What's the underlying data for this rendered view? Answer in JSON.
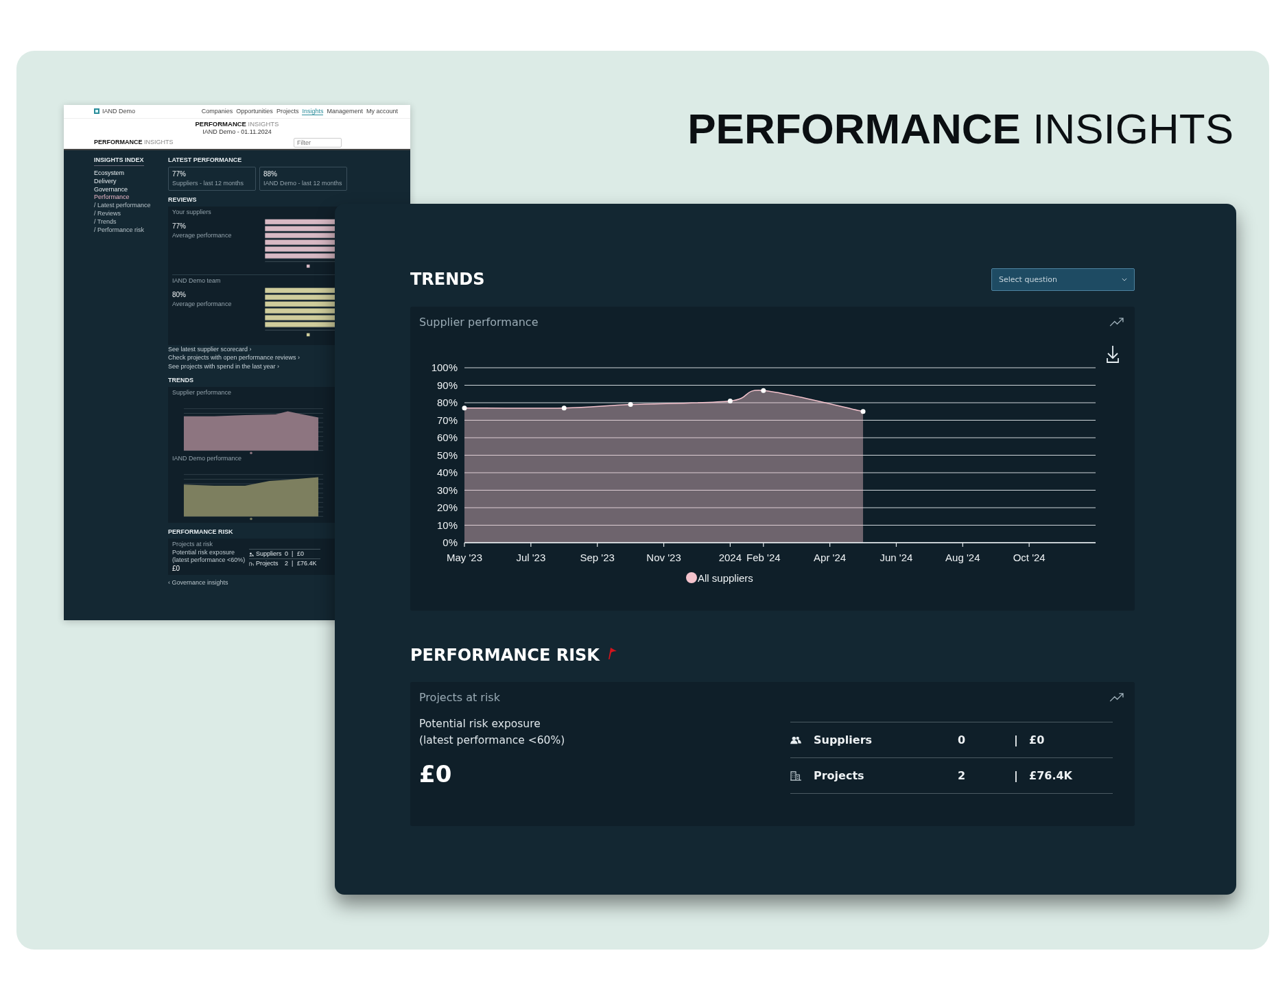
{
  "heading": {
    "bold": "PERFORMANCE",
    "light": "INSIGHTS"
  },
  "preview": {
    "brand": "IAND Demo",
    "nav": [
      {
        "label": "Companies",
        "selected": false
      },
      {
        "label": "Opportunities",
        "selected": false
      },
      {
        "label": "Projects",
        "selected": false
      },
      {
        "label": "Insights",
        "selected": true
      },
      {
        "label": "Management",
        "selected": false
      },
      {
        "label": "My account",
        "selected": false
      }
    ],
    "title": {
      "bold": "PERFORMANCE",
      "light": "INSIGHTS"
    },
    "subtitle": "IAND Demo - 01.11.2024",
    "section_title": {
      "bold": "PERFORMANCE",
      "light": "INSIGHTS"
    },
    "filter": {
      "placeholder": "Filter"
    },
    "index": {
      "title": "INSIGHTS INDEX",
      "items": [
        {
          "label": "Ecosystem",
          "selected": false
        },
        {
          "label": "Delivery",
          "selected": false
        },
        {
          "label": "Governance",
          "selected": false
        },
        {
          "label": "Performance",
          "selected": true
        }
      ],
      "subitems": [
        "/ Latest performance",
        "/ Reviews",
        "/ Trends",
        "/ Performance risk"
      ]
    },
    "latest": {
      "title": "LATEST PERFORMANCE",
      "cards": [
        {
          "value": "77%",
          "label": "Suppliers - last 12 months"
        },
        {
          "value": "88%",
          "label": "IAND Demo - last 12 months"
        }
      ]
    },
    "reviews": {
      "title": "REVIEWS",
      "panels": [
        {
          "name": "Your suppliers",
          "value": "77%",
          "label": "Average performance",
          "color": "#d8b9c4"
        },
        {
          "name": "IAND Demo team",
          "value": "80%",
          "label": "Average performance",
          "color": "#cfcd9c"
        }
      ]
    },
    "links": [
      "See latest supplier scorecard ›",
      "Check projects with open performance reviews ›",
      "See projects with spend in the last year ›"
    ],
    "trends": {
      "title": "TRENDS",
      "panels": [
        {
          "name": "Supplier performance",
          "color": "#8d7580"
        },
        {
          "name": "IAND Demo performance",
          "color": "#7d7f5f"
        }
      ]
    },
    "risk": {
      "title": "PERFORMANCE RISK",
      "card": "Projects at risk",
      "label": "Potential risk exposure",
      "sublabel": "(latest performance <60%)",
      "value": "£0",
      "rows": [
        {
          "kind": "suppliers",
          "label": "Suppliers",
          "count": "0",
          "divider": "|",
          "amount": "£0"
        },
        {
          "kind": "projects",
          "label": "Projects",
          "count": "2",
          "divider": "|",
          "amount": "£76.4K"
        }
      ]
    },
    "back": "‹ Governance insights"
  },
  "trends": {
    "title": "TRENDS",
    "select": {
      "placeholder": "Select question"
    },
    "card": {
      "title": "Supplier performance",
      "chart_data": {
        "type": "area",
        "categories": [
          "May '23",
          null,
          "Jul '23",
          null,
          "Sep '23",
          null,
          "Nov '23",
          null,
          "2024",
          "Feb '24",
          null,
          "Apr '24",
          null,
          "Jun '24",
          null,
          "Aug '24",
          null,
          "Oct '24",
          null
        ],
        "series": [
          {
            "name": "All suppliers",
            "color": "#f4c3cd",
            "values": [
              77,
              null,
              null,
              77,
              null,
              79,
              null,
              null,
              81,
              87,
              null,
              null,
              75,
              null,
              null,
              null,
              null,
              null,
              null
            ]
          }
        ],
        "ylim": [
          0,
          100
        ],
        "grid": true,
        "yticks": [
          {
            "value": 0,
            "label": "0%"
          },
          {
            "value": 10,
            "label": "10%"
          },
          {
            "value": 20,
            "label": "20%"
          },
          {
            "value": 30,
            "label": "30%"
          },
          {
            "value": 40,
            "label": "40%"
          },
          {
            "value": 50,
            "label": "50%"
          },
          {
            "value": 60,
            "label": "60%"
          },
          {
            "value": 70,
            "label": "70%"
          },
          {
            "value": 80,
            "label": "80%"
          },
          {
            "value": 90,
            "label": "90%"
          },
          {
            "value": 100,
            "label": "100%"
          }
        ]
      }
    }
  },
  "risk": {
    "title": "PERFORMANCE RISK",
    "card": "Projects at risk",
    "label": "Potential risk exposure",
    "sublabel": "(latest performance <60%)",
    "value": "£0",
    "rows": [
      {
        "kind": "suppliers",
        "label": "Suppliers",
        "count": "0",
        "divider": "|",
        "amount": "£0"
      },
      {
        "kind": "projects",
        "label": "Projects",
        "count": "2",
        "divider": "|",
        "amount": "£76.4K"
      }
    ]
  }
}
